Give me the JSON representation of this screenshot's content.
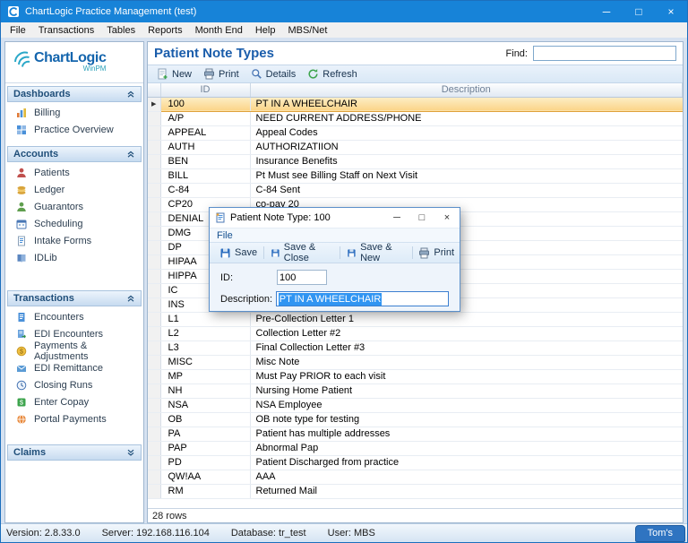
{
  "window": {
    "title": "ChartLogic Practice Management (test)"
  },
  "icons": {
    "minimize": "─",
    "maximize": "□",
    "close": "×",
    "row_marker": "▶"
  },
  "menubar": {
    "items": [
      "File",
      "Transactions",
      "Tables",
      "Reports",
      "Month End",
      "Help",
      "MBS/Net"
    ]
  },
  "sidebar": {
    "logo": "ChartLogic",
    "logo_sub": "WinPM",
    "sections": [
      {
        "label": "Dashboards",
        "collapsed": false,
        "items": [
          {
            "label": "Billing"
          },
          {
            "label": "Practice Overview"
          }
        ]
      },
      {
        "label": "Accounts",
        "collapsed": false,
        "items": [
          {
            "label": "Patients"
          },
          {
            "label": "Ledger"
          },
          {
            "label": "Guarantors"
          },
          {
            "label": "Scheduling"
          },
          {
            "label": "Intake Forms"
          },
          {
            "label": "IDLib"
          }
        ]
      },
      {
        "label": "Transactions",
        "collapsed": false,
        "items": [
          {
            "label": "Encounters"
          },
          {
            "label": "EDI Encounters"
          },
          {
            "label": "Payments & Adjustments"
          },
          {
            "label": "EDI Remittance"
          },
          {
            "label": "Closing Runs"
          },
          {
            "label": "Enter Copay"
          },
          {
            "label": "Portal Payments"
          }
        ]
      },
      {
        "label": "Claims",
        "collapsed": true,
        "items": []
      }
    ]
  },
  "main": {
    "title": "Patient Note Types",
    "find": {
      "label": "Find:",
      "value": ""
    },
    "toolbar": [
      {
        "label": "New"
      },
      {
        "label": "Print"
      },
      {
        "label": "Details"
      },
      {
        "label": "Refresh"
      }
    ],
    "table": {
      "columns": [
        "ID",
        "Description"
      ],
      "selected_index": 0,
      "footer": "28 rows",
      "rows": [
        {
          "id": "100",
          "description": "PT IN A WHEELCHAIR"
        },
        {
          "id": "A/P",
          "description": "NEED CURRENT ADDRESS/PHONE"
        },
        {
          "id": "APPEAL",
          "description": "Appeal Codes"
        },
        {
          "id": "AUTH",
          "description": "AUTHORIZATIION"
        },
        {
          "id": "BEN",
          "description": "Insurance Benefits"
        },
        {
          "id": "BILL",
          "description": "Pt Must see Billing Staff on Next Visit"
        },
        {
          "id": "C-84",
          "description": "C-84 Sent"
        },
        {
          "id": "CP20",
          "description": "co-pay 20"
        },
        {
          "id": "DENIAL",
          "description": ""
        },
        {
          "id": "DMG",
          "description": ""
        },
        {
          "id": "DP",
          "description": ""
        },
        {
          "id": "HIPAA",
          "description": ""
        },
        {
          "id": "HIPPA",
          "description": ""
        },
        {
          "id": "IC",
          "description": ""
        },
        {
          "id": "INS",
          "description": ""
        },
        {
          "id": "L1",
          "description": "Pre-Collection Letter 1"
        },
        {
          "id": "L2",
          "description": "Collection Letter #2"
        },
        {
          "id": "L3",
          "description": "Final Collection Letter #3"
        },
        {
          "id": "MISC",
          "description": "Misc Note"
        },
        {
          "id": "MP",
          "description": "Must Pay PRIOR to each visit"
        },
        {
          "id": "NH",
          "description": "Nursing Home Patient"
        },
        {
          "id": "NSA",
          "description": "NSA Employee"
        },
        {
          "id": "OB",
          "description": "OB note type for testing"
        },
        {
          "id": "PA",
          "description": "Patient has multiple addresses"
        },
        {
          "id": "PAP",
          "description": "Abnormal Pap"
        },
        {
          "id": "PD",
          "description": "Patient Discharged from practice"
        },
        {
          "id": "QW!AA",
          "description": "AAA"
        },
        {
          "id": "RM",
          "description": "Returned Mail"
        }
      ]
    }
  },
  "dialog": {
    "title": "Patient Note Type: 100",
    "menu": "File",
    "toolbar": [
      {
        "label": "Save"
      },
      {
        "label": "Save & Close"
      },
      {
        "label": "Save & New"
      },
      {
        "label": "Print"
      }
    ],
    "fields": {
      "id_label": "ID:",
      "id_value": "100",
      "description_label": "Description:",
      "description_value": "PT IN A WHEELCHAIR"
    }
  },
  "statusbar": {
    "items": [
      "Version: 2.8.33.0",
      "Server: 192.168.116.104",
      "Database: tr_test",
      "User: MBS"
    ],
    "badge": "Tom's"
  }
}
